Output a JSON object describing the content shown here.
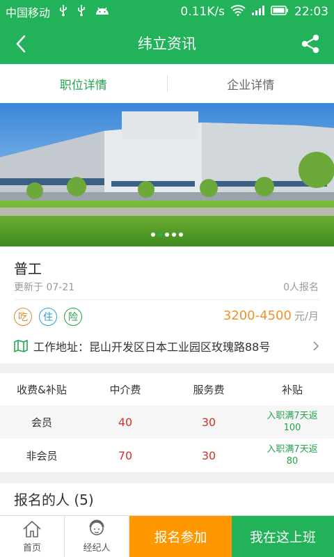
{
  "status_bar": {
    "carrier": "中国移动",
    "net_speed": "0.11K/s",
    "time": "22:03",
    "icons": [
      "usb-icon",
      "usb-icon",
      "android-icon",
      "wifi-icon",
      "signal-icon",
      "battery-icon"
    ]
  },
  "header": {
    "title": "纬立资讯",
    "back_icon": "chevron-left-icon",
    "share_icon": "share-icon"
  },
  "tabs": [
    {
      "label": "职位详情",
      "active": true
    },
    {
      "label": "企业详情",
      "active": false
    }
  ],
  "banner": {
    "slide_count": 5,
    "active_index": 1
  },
  "job": {
    "title": "普工",
    "updated": "更新于 07-21",
    "signups": "0人报名",
    "perks": [
      {
        "label": "吃",
        "color": "#e08a2a"
      },
      {
        "label": "住",
        "color": "#2a9fd6"
      },
      {
        "label": "险",
        "color": "#27a24d"
      }
    ],
    "salary": "3200-4500",
    "salary_unit": "元/月",
    "address": "工作地址：昆山开发区日本工业园区玫瑰路88号"
  },
  "fees": {
    "headers": [
      "收费&补贴",
      "中介费",
      "服务费",
      "补贴"
    ],
    "rows": [
      {
        "type": "会员",
        "agency_fee": "40",
        "service_fee": "30",
        "subsidy_line1": "入职满7天返",
        "subsidy_line2": "100"
      },
      {
        "type": "非会员",
        "agency_fee": "70",
        "service_fee": "30",
        "subsidy_line1": "入职满7天返",
        "subsidy_line2": "80"
      }
    ]
  },
  "applicants": {
    "label": "报名的人 (5)"
  },
  "bottom_nav": {
    "home_label": "首页",
    "agent_label": "经纪人",
    "signup_label": "报名参加",
    "work_here_label": "我在这上班"
  },
  "colors": {
    "brand_green": "#22b35a",
    "accent_orange": "#ff9800",
    "salary_orange": "#f0902a",
    "fee_red": "#d0332c"
  }
}
